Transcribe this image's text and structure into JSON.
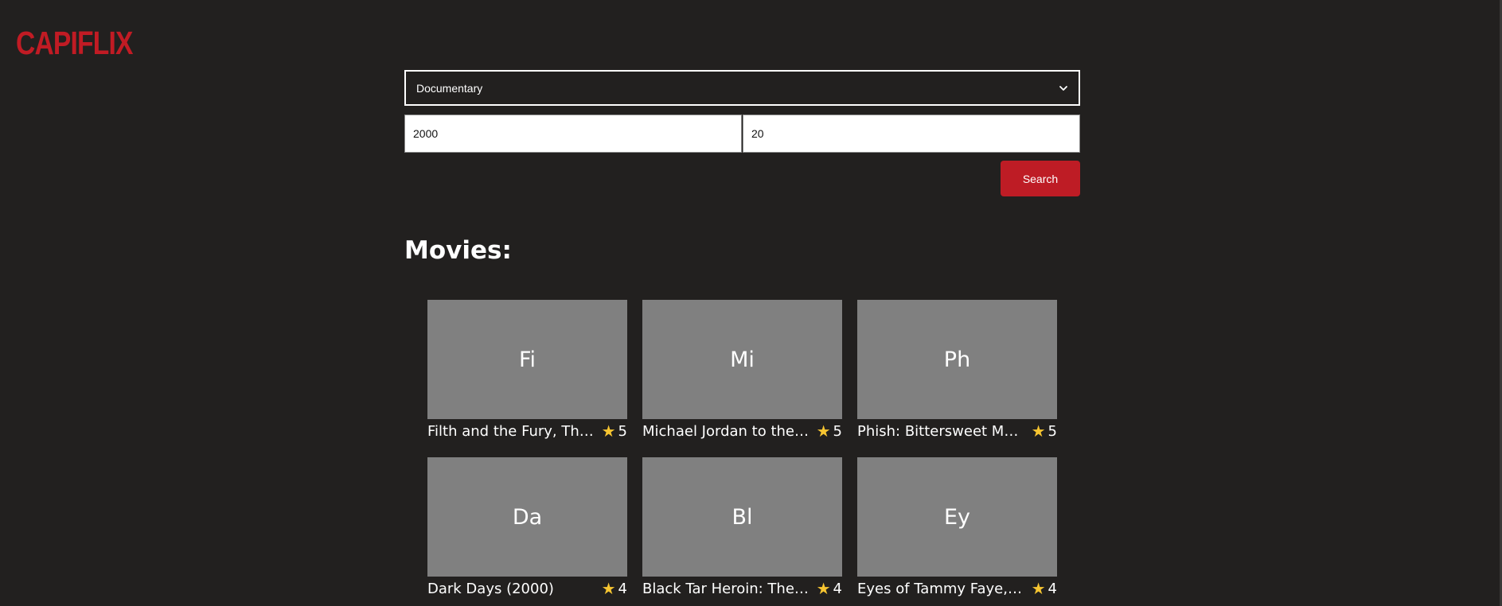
{
  "app": {
    "logo": "CAPIFLIX"
  },
  "search": {
    "genre": "Documentary",
    "year": "2000",
    "limit": "20",
    "button_label": "Search"
  },
  "movies_section": {
    "title": "Movies:"
  },
  "movies": [
    {
      "initials": "Fi",
      "title": "Filth and the Fury, The ...",
      "rating": "5"
    },
    {
      "initials": "Mi",
      "title": "Michael Jordan to the ...",
      "rating": "5"
    },
    {
      "initials": "Ph",
      "title": "Phish: Bittersweet Mot...",
      "rating": "5"
    },
    {
      "initials": "Da",
      "title": "Dark Days (2000)",
      "rating": "4"
    },
    {
      "initials": "Bl",
      "title": "Black Tar Heroin: The D...",
      "rating": "4"
    },
    {
      "initials": "Ey",
      "title": "Eyes of Tammy Faye, T...",
      "rating": "4"
    }
  ],
  "icons": {
    "star": "★",
    "chevron": "chevron-down-icon"
  },
  "colors": {
    "background": "#22201f",
    "brand": "#c11b24",
    "button": "#be1c25",
    "thumbnail": "#808080",
    "star": "#f7c531"
  }
}
